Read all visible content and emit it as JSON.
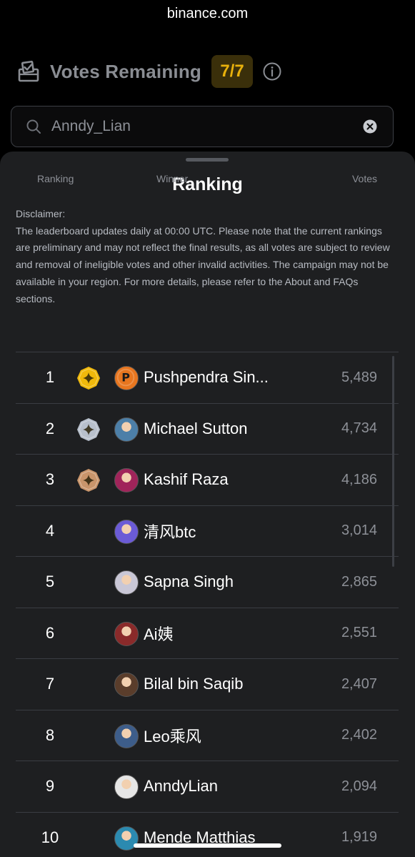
{
  "browser": {
    "url": "binance.com"
  },
  "votes": {
    "title": "Votes Remaining",
    "remaining": "7/7"
  },
  "search": {
    "value": "Anndy_Lian"
  },
  "sheet": {
    "title": "Ranking",
    "disclaimer_label": "Disclaimer:",
    "disclaimer_text": "The leaderboard updates daily at 00:00 UTC. Please note that the current rankings are preliminary and may not reflect the final results, as all votes are subject to review and removal of ineligible votes and other invalid activities. The campaign may not be available in your region. For more details, please refer to the About and FAQs sections."
  },
  "table": {
    "headers": {
      "rank": "Ranking",
      "winner": "Winner",
      "votes": "Votes"
    },
    "rows": [
      {
        "rank": "1",
        "name": "Pushpendra Sin...",
        "votes": "5,489",
        "medal": "gold",
        "avatar_color": "#e8761f"
      },
      {
        "rank": "2",
        "name": "Michael Sutton",
        "votes": "4,734",
        "medal": "silver",
        "avatar_color": "#4c7fa8"
      },
      {
        "rank": "3",
        "name": "Kashif Raza",
        "votes": "4,186",
        "medal": "bronze",
        "avatar_color": "#a0245a"
      },
      {
        "rank": "4",
        "name": "清风btc",
        "votes": "3,014",
        "medal": "",
        "avatar_color": "#6b5bd6"
      },
      {
        "rank": "5",
        "name": "Sapna Singh",
        "votes": "2,865",
        "medal": "",
        "avatar_color": "#c9c7d6"
      },
      {
        "rank": "6",
        "name": "Ai姨",
        "votes": "2,551",
        "medal": "",
        "avatar_color": "#8a2a2a"
      },
      {
        "rank": "7",
        "name": "Bilal bin Saqib",
        "votes": "2,407",
        "medal": "",
        "avatar_color": "#5a3d2b"
      },
      {
        "rank": "8",
        "name": "Leo乘风",
        "votes": "2,402",
        "medal": "",
        "avatar_color": "#3d5d8a"
      },
      {
        "rank": "9",
        "name": "AnndyLian",
        "votes": "2,094",
        "medal": "",
        "avatar_color": "#e6e6e6"
      },
      {
        "rank": "10",
        "name": "Mende Matthias",
        "votes": "1,919",
        "medal": "",
        "avatar_color": "#2b8ab0"
      }
    ]
  },
  "colors": {
    "gold": "#f0b90b",
    "silver": "#b8c0cc",
    "bronze": "#c9956b",
    "badge_text": "#e8b10c",
    "badge_bg": "#3a2f0a"
  }
}
